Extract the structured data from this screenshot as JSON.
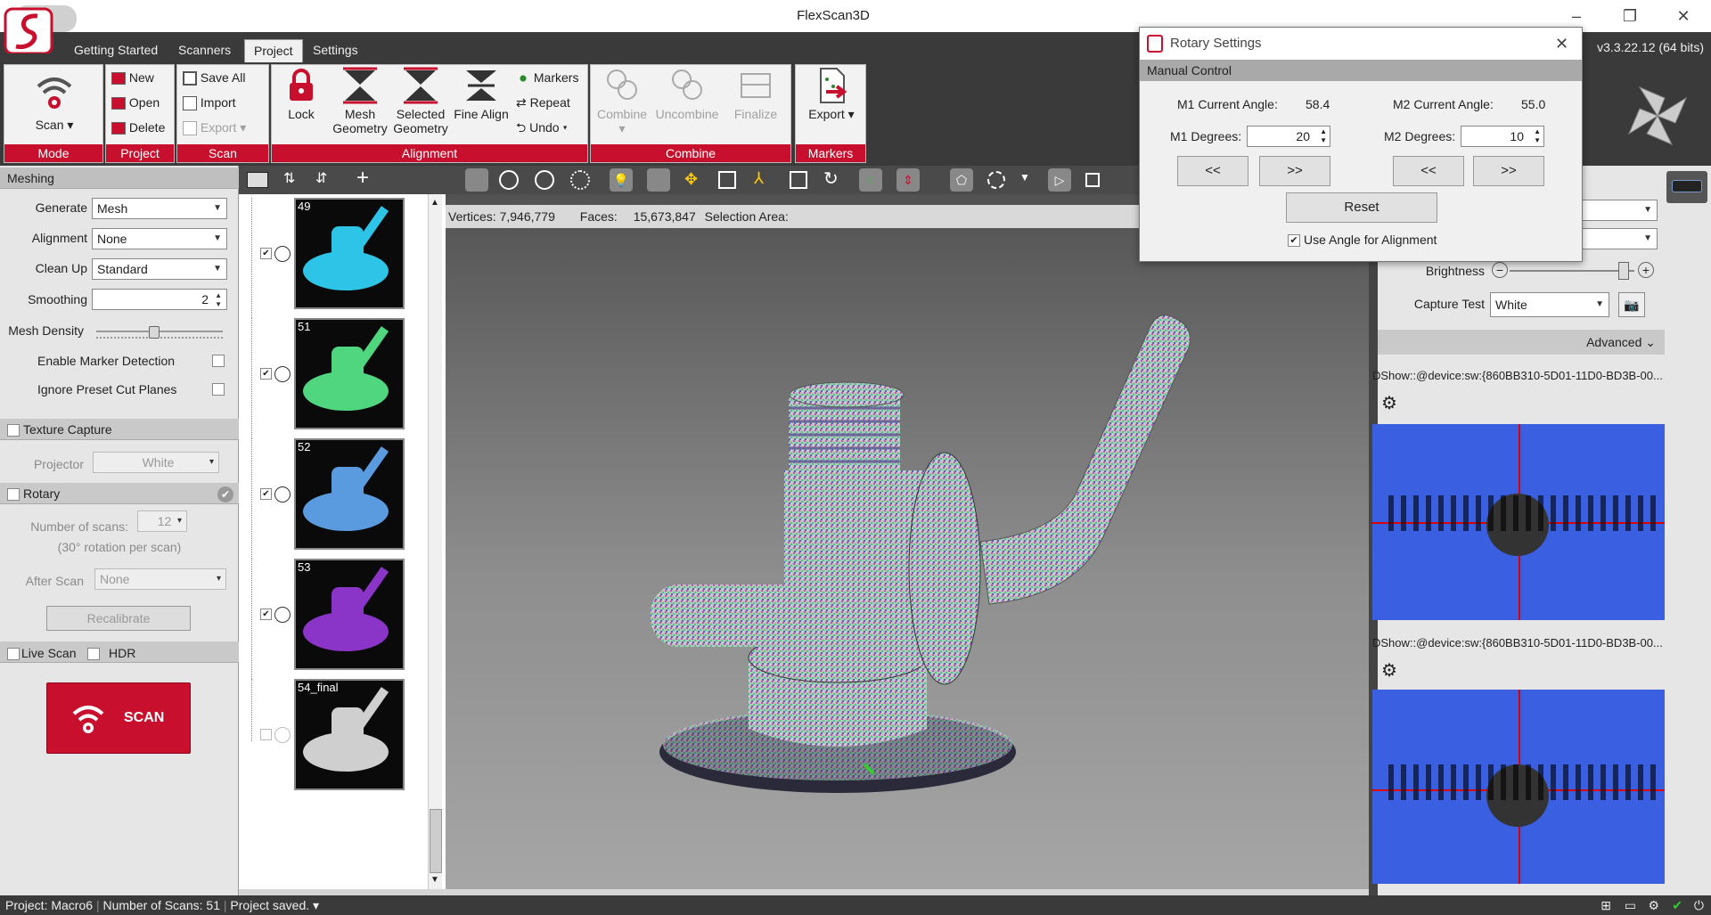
{
  "app": {
    "title": "FlexScan3D",
    "version": "v3.3.22.12 (64 bits)"
  },
  "menu": {
    "tabs": [
      "Getting Started",
      "Scanners",
      "Project",
      "Settings"
    ],
    "active": "Project"
  },
  "ribbon": {
    "mode": {
      "label": "Mode",
      "scan": "Scan"
    },
    "project": {
      "label": "Project",
      "new": "New",
      "open": "Open",
      "delete": "Delete"
    },
    "scan": {
      "label": "Scan",
      "save_all": "Save All",
      "import": "Import",
      "export": "Export"
    },
    "alignment": {
      "label": "Alignment",
      "lock": "Lock",
      "mesh_geometry_1": "Mesh",
      "mesh_geometry_2": "Geometry",
      "selected_geometry_1": "Selected",
      "selected_geometry_2": "Geometry",
      "fine_align": "Fine Align",
      "markers": "Markers",
      "repeat": "Repeat",
      "undo": "Undo"
    },
    "combine": {
      "label": "Combine",
      "combine": "Combine",
      "uncombine": "Uncombine",
      "finalize": "Finalize"
    },
    "markers": {
      "label": "Markers",
      "export": "Export"
    }
  },
  "meshing": {
    "title": "Meshing",
    "generate_label": "Generate",
    "generate": "Mesh",
    "alignment_label": "Alignment",
    "alignment": "None",
    "cleanup_label": "Clean Up",
    "cleanup": "Standard",
    "smoothing_label": "Smoothing",
    "smoothing": "2",
    "density_label": "Mesh Density",
    "density": 0.45,
    "marker_detection": "Enable Marker Detection",
    "ignore_cut_planes": "Ignore Preset Cut Planes"
  },
  "texture": {
    "title": "Texture Capture",
    "projector_label": "Projector",
    "projector": "White"
  },
  "rotary": {
    "title": "Rotary",
    "num_scans_label": "Number of scans:",
    "num_scans": "12",
    "rotation_note": "(30° rotation per scan)",
    "after_scan_label": "After Scan",
    "after_scan": "None",
    "recalibrate": "Recalibrate"
  },
  "live": {
    "live_scan": "Live Scan",
    "hdr": "HDR",
    "scan_button": "SCAN"
  },
  "scans": [
    {
      "id": "49",
      "color": "#2ec4e8"
    },
    {
      "id": "51",
      "color": "#4fd67f"
    },
    {
      "id": "52",
      "color": "#5a9be0"
    },
    {
      "id": "53",
      "color": "#8a35c8"
    },
    {
      "id": "54_final",
      "color": "#cfcfcf"
    }
  ],
  "stats": {
    "vertices_label": "Vertices:",
    "vertices": "7,946,779",
    "faces_label": "Faces:",
    "faces": "15,673,847",
    "selection_label": "Selection Area:"
  },
  "right": {
    "brightness_label": "Brightness",
    "capture_test_label": "Capture Test",
    "capture_test": "White",
    "advanced": "Advanced",
    "device1": "DShow::@device:sw:{860BB310-5D01-11D0-BD3B-00...",
    "device2": "DShow::@device:sw:{860BB310-5D01-11D0-BD3B-00..."
  },
  "status": {
    "project": "Project:",
    "project_name": "Macro6",
    "num_scans_label": "Number of Scans:",
    "num_scans": "51",
    "saved": "Project saved."
  },
  "dialog": {
    "title": "Rotary Settings",
    "section": "Manual Control",
    "m1_angle_label": "M1 Current Angle:",
    "m1_angle": "58.4",
    "m2_angle_label": "M2 Current Angle:",
    "m2_angle": "55.0",
    "m1_deg_label": "M1 Degrees:",
    "m1_deg": "20",
    "m2_deg_label": "M2 Degrees:",
    "m2_deg": "10",
    "prev": "<<",
    "next": ">>",
    "reset": "Reset",
    "use_angle": "Use Angle for Alignment"
  },
  "colors": {
    "accent": "#c8102e",
    "dark": "#3a3a3a",
    "camera_bg": "#3a5fe0"
  }
}
